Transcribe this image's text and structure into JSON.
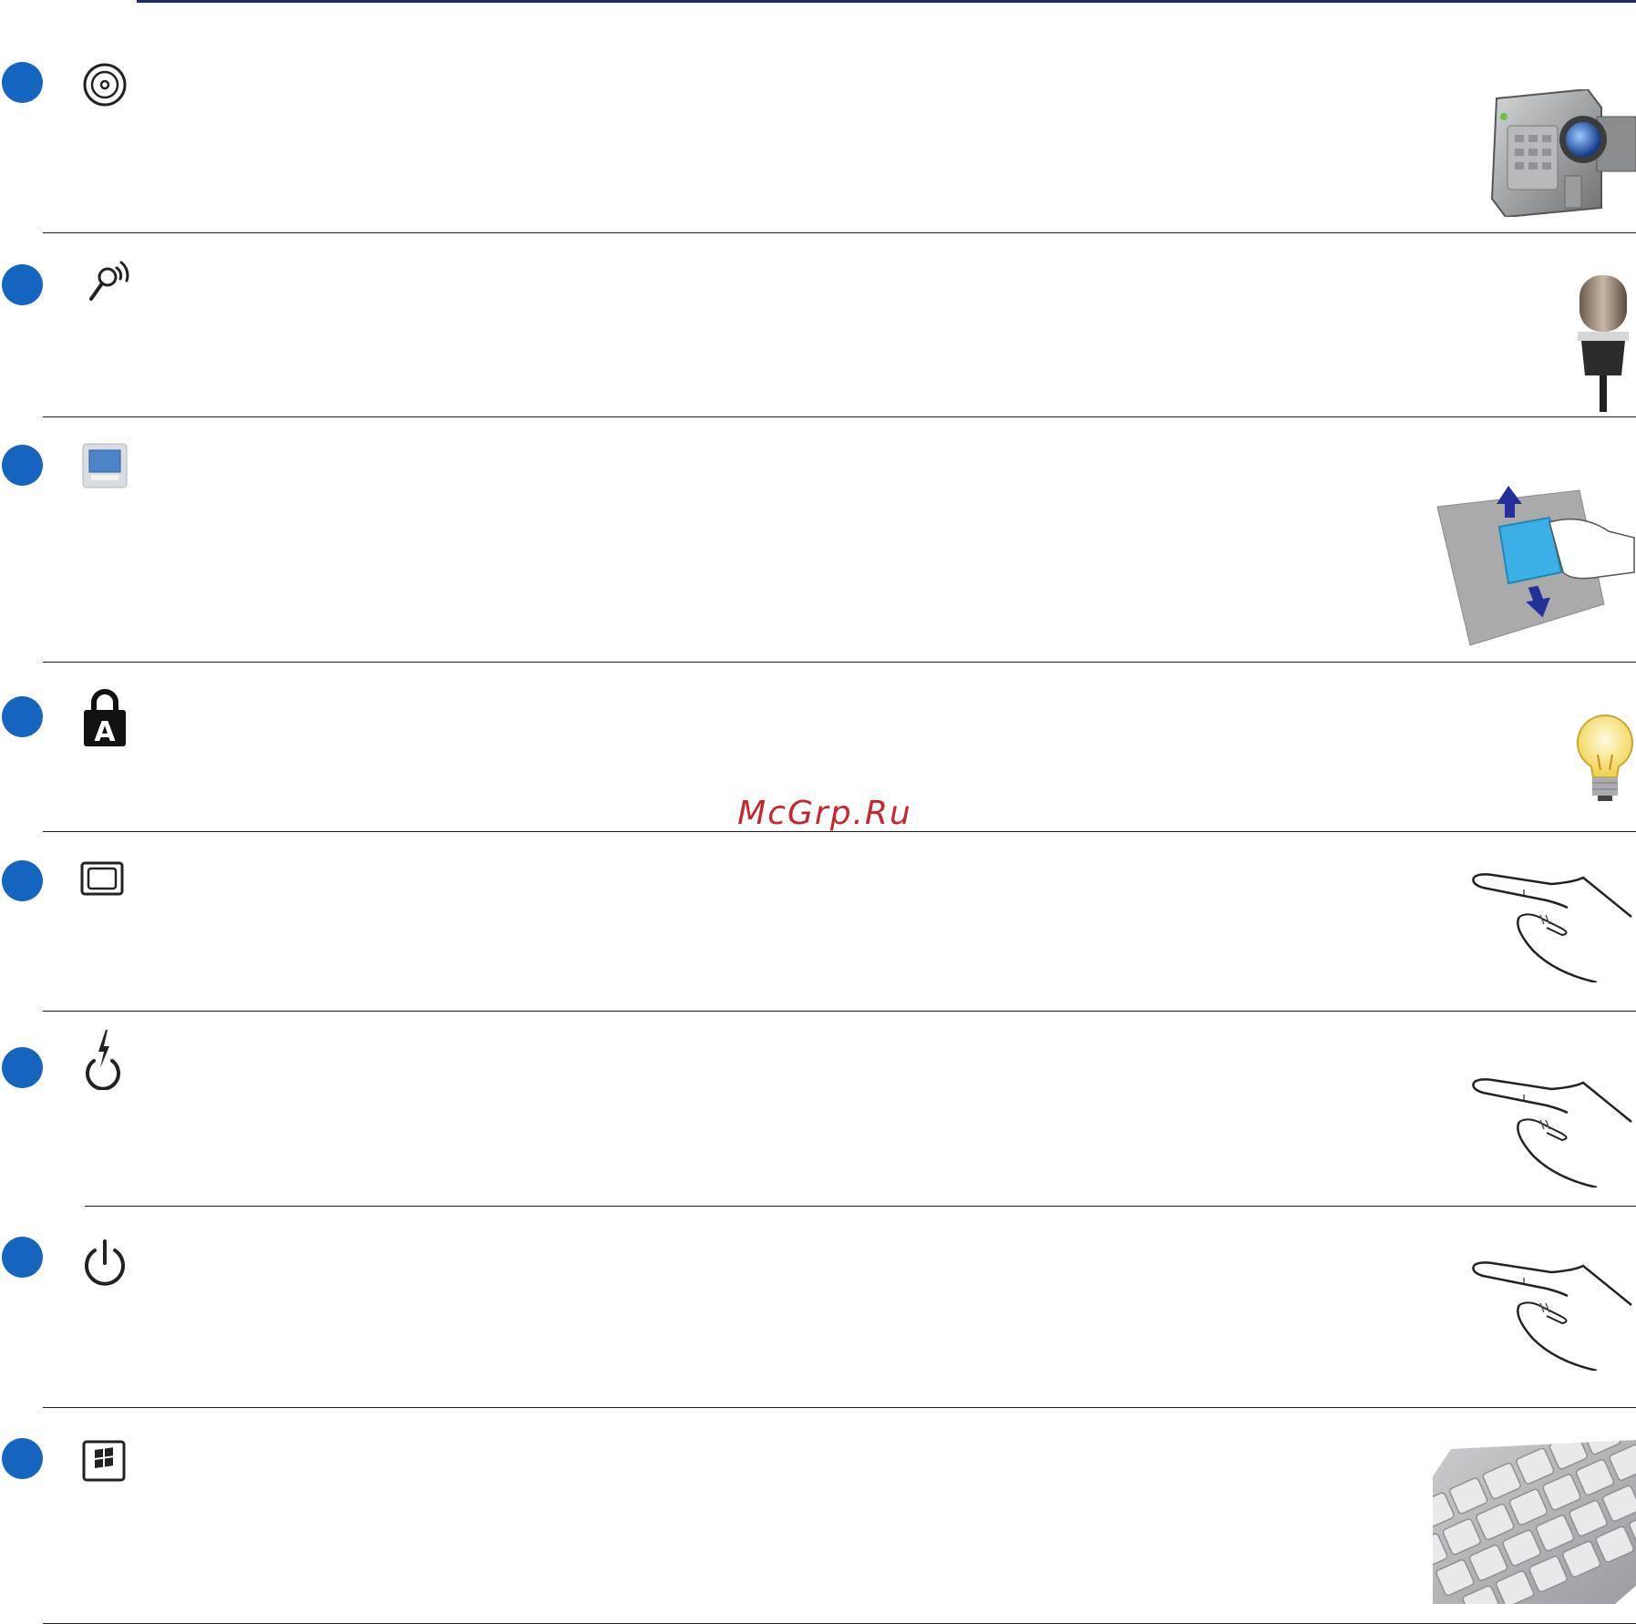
{
  "watermark": {
    "text": "McGrp.Ru"
  },
  "colors": {
    "bullet": "#1565c0",
    "top_rule": "#1b2a6b",
    "divider": "#1a1a1a",
    "watermark": "#c4282e"
  },
  "items": [
    {
      "icon": "optical-disc-icon",
      "illustration": "camcorder"
    },
    {
      "icon": "microphone-icon",
      "illustration": "studio-microphone"
    },
    {
      "icon": "display-icon",
      "illustration": "screen-cleaning"
    },
    {
      "icon": "capital-lock-icon",
      "illustration": "light-bulb"
    },
    {
      "icon": "screen-off-icon",
      "illustration": "finger-press"
    },
    {
      "icon": "power4gear-icon",
      "illustration": "finger-press"
    },
    {
      "icon": "power-icon",
      "illustration": "finger-press"
    },
    {
      "icon": "windows-key-icon",
      "illustration": "keyboard-closeup"
    }
  ]
}
